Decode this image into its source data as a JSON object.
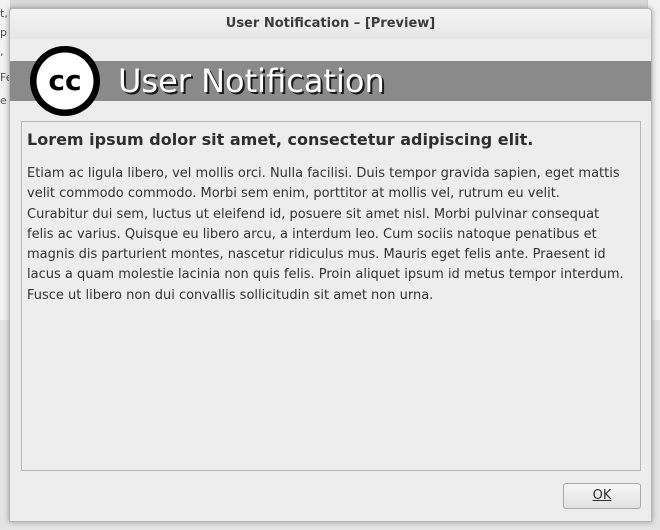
{
  "background_window": {
    "fragments": [
      "t,",
      "p",
      ",",
      "Fe",
      "e"
    ]
  },
  "dialog": {
    "title": "User Notification – [Preview]",
    "banner": {
      "logo_text": "cc",
      "logo_icon": "creative-commons-icon",
      "title": "User Notification"
    },
    "message": {
      "heading": "Lorem ipsum dolor sit amet, consectetur adipiscing elit.",
      "lines": [
        "Etiam ac ligula libero, vel mollis orci. Nulla facilisi. Duis tempor gravida sapien, eget mattis",
        "velit commodo commodo. Morbi sem enim, porttitor at mollis vel, rutrum eu velit.",
        "Curabitur dui sem, luctus ut eleifend id, posuere sit amet nisl. Morbi pulvinar consequat",
        "felis ac varius. Quisque eu libero arcu, a interdum leo. Cum sociis natoque penatibus et",
        "magnis dis parturient montes, nascetur ridiculus mus. Mauris eget felis ante. Praesent id",
        "lacus a quam molestie lacinia non quis felis. Proin aliquet ipsum id metus tempor interdum.",
        "Fusce ut libero non dui convallis sollicitudin sit amet non urna."
      ]
    },
    "ok_label": "OK"
  },
  "colors": {
    "banner_bg": "#8a8a8a",
    "banner_text": "#ffffff",
    "dialog_bg": "#ededed"
  }
}
